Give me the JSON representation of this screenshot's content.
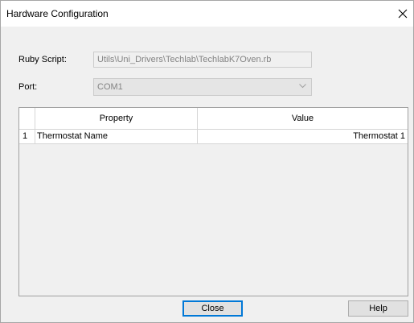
{
  "window": {
    "title": "Hardware Configuration",
    "close_glyph": "✕"
  },
  "form": {
    "ruby_script_label": "Ruby Script:",
    "ruby_script_value": "Utils\\Uni_Drivers\\Techlab\\TechlabK7Oven.rb",
    "port_label": "Port:",
    "port_value": "COM1"
  },
  "grid": {
    "columns": [
      "Property",
      "Value"
    ],
    "rows": [
      {
        "index": "1",
        "property": "Thermostat Name",
        "value": "Thermostat 1"
      }
    ]
  },
  "buttons": {
    "close_label": "Close",
    "help_label": "Help"
  },
  "icons": {
    "window_close": "close-icon",
    "dropdown": "chevron-down-icon"
  },
  "colors": {
    "default_button_border": "#0078d7",
    "disabled_text": "#838383",
    "background": "#f0f0f0"
  }
}
